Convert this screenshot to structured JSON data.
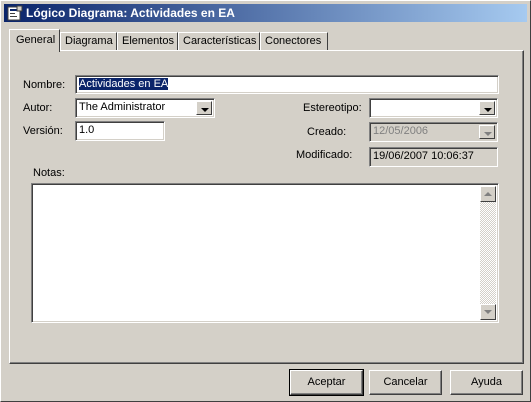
{
  "window": {
    "title": "Lógico Diagrama: Actividades en EA",
    "icon": "diagram-properties-icon"
  },
  "tabs": [
    {
      "label": "General",
      "active": true
    },
    {
      "label": "Diagrama"
    },
    {
      "label": "Elementos"
    },
    {
      "label": "Características"
    },
    {
      "label": "Conectores"
    }
  ],
  "form": {
    "nombre_label": "Nombre:",
    "nombre_value": "Actividades en EA",
    "autor_label": "Autor:",
    "autor_value": "The Administrator",
    "version_label": "Versión:",
    "version_value": "1.0",
    "estereotipo_label": "Estereotipo:",
    "estereotipo_value": "",
    "creado_label": "Creado:",
    "creado_value": "12/05/2006",
    "modificado_label": "Modificado:",
    "modificado_value": "19/06/2007 10:06:37",
    "notas_label": "Notas:",
    "notas_value": ""
  },
  "buttons": {
    "aceptar": "Aceptar",
    "cancelar": "Cancelar",
    "ayuda": "Ayuda"
  },
  "colors": {
    "titlebar_start": "#0a246a",
    "titlebar_end": "#a6caf0",
    "face": "#d4d0c8",
    "selection": "#0a246a"
  }
}
